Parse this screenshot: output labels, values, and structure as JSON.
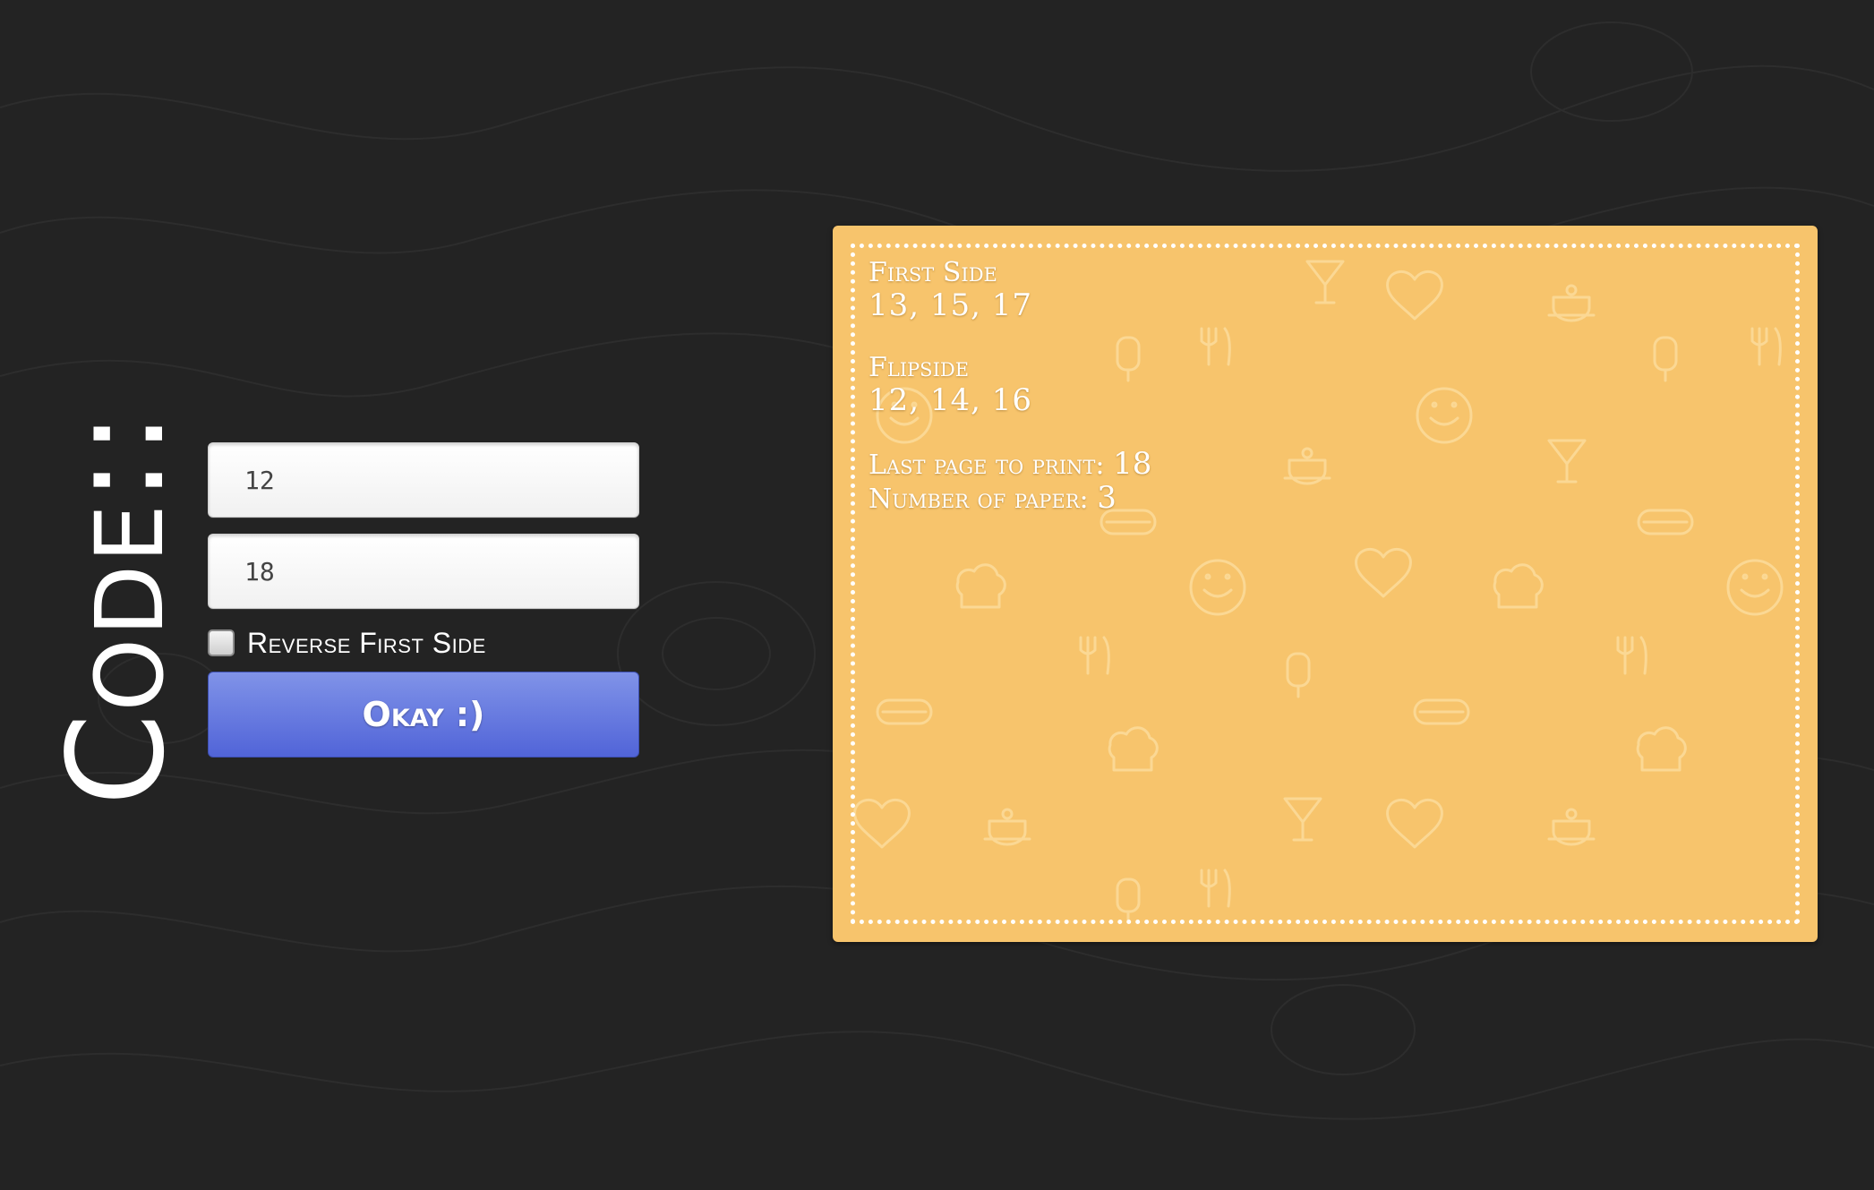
{
  "logo": {
    "text": "Code::"
  },
  "form": {
    "first_input_value": "12",
    "second_input_value": "18",
    "reverse_label": "Reverse First Side",
    "reverse_checked": false,
    "submit_label": "Okay :)"
  },
  "result": {
    "first_side_heading": "First Side",
    "first_side_pages": "13, 15, 17",
    "flipside_heading": "Flipside",
    "flipside_pages": "12, 14, 16",
    "last_page_label": "Last page to print:",
    "last_page_value": "18",
    "paper_count_label": "Number of paper:",
    "paper_count_value": "3"
  },
  "colors": {
    "background": "#232323",
    "card": "#f7c46c",
    "button": "#5b6fdc"
  }
}
